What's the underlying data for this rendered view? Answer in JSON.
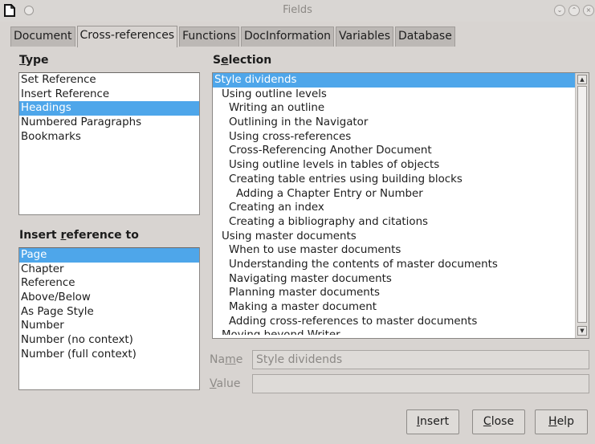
{
  "window": {
    "title": "Fields"
  },
  "tabs": [
    "Document",
    "Cross-references",
    "Functions",
    "DocInformation",
    "Variables",
    "Database"
  ],
  "active_tab": "Cross-references",
  "type": {
    "label_mnemonic": "T",
    "label_rest": "ype",
    "items": [
      "Set Reference",
      "Insert Reference",
      "Headings",
      "Numbered Paragraphs",
      "Bookmarks"
    ],
    "selected": "Headings"
  },
  "insert_reference_to": {
    "label_pre": "Insert ",
    "label_mnemonic": "r",
    "label_post": "eference to",
    "items": [
      "Page",
      "Chapter",
      "Reference",
      "Above/Below",
      "As Page Style",
      "Number",
      "Number (no context)",
      "Number (full context)"
    ],
    "selected": "Page"
  },
  "selection": {
    "label_pre": "S",
    "label_mnemonic": "e",
    "label_post": "lection",
    "items": [
      {
        "text": "Style dividends",
        "level": 0
      },
      {
        "text": "Using outline levels",
        "level": 1
      },
      {
        "text": "Writing an outline",
        "level": 2
      },
      {
        "text": "Outlining in the Navigator",
        "level": 2
      },
      {
        "text": "Using cross-references",
        "level": 2
      },
      {
        "text": "Cross-Referencing Another Document",
        "level": 2
      },
      {
        "text": "Using outline levels in tables of objects",
        "level": 2
      },
      {
        "text": "Creating table entries using building blocks",
        "level": 2
      },
      {
        "text": "Adding a Chapter Entry or Number",
        "level": 3
      },
      {
        "text": "Creating an index",
        "level": 2
      },
      {
        "text": "Creating a bibliography and citations",
        "level": 2
      },
      {
        "text": "Using master documents",
        "level": 1
      },
      {
        "text": "When to use master documents",
        "level": 2
      },
      {
        "text": "Understanding the contents of master documents",
        "level": 2
      },
      {
        "text": "Navigating master documents",
        "level": 2
      },
      {
        "text": "Planning master documents",
        "level": 2
      },
      {
        "text": "Making a master document",
        "level": 2
      },
      {
        "text": "Adding cross-references to master documents",
        "level": 2
      },
      {
        "text": "Moving beyond Writer",
        "level": 1
      }
    ],
    "selected": "Style dividends"
  },
  "name_field": {
    "label_pre": "Na",
    "label_mnemonic": "m",
    "label_post": "e",
    "value": "Style dividends"
  },
  "value_field": {
    "label_mnemonic": "V",
    "label_post": "alue",
    "value": ""
  },
  "buttons": {
    "insert": {
      "mnemonic": "I",
      "rest": "nsert"
    },
    "close": {
      "mnemonic": "C",
      "rest": "lose"
    },
    "help": {
      "mnemonic": "H",
      "rest": "elp"
    }
  },
  "colors": {
    "selection": "#4ea6ea",
    "dialog_bg": "#d8d4d1",
    "tab_inactive": "#bcb8b5"
  }
}
